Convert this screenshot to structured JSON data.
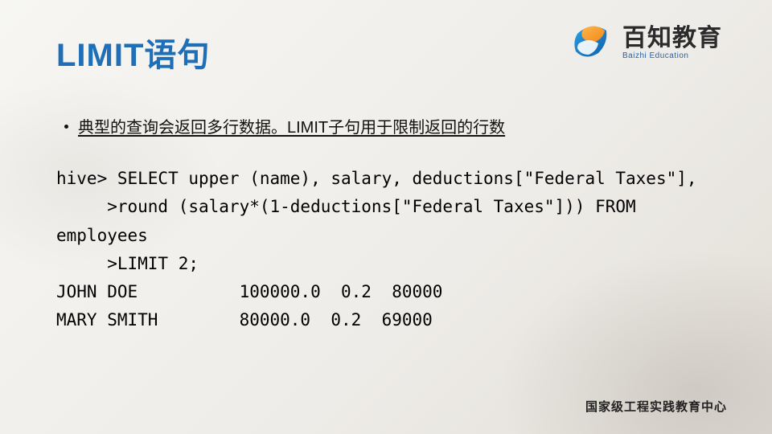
{
  "title": "LIMIT语句",
  "logo": {
    "main": "百知教育",
    "sub": "Baizhi Education"
  },
  "bullet": "典型的查询会返回多行数据。LIMIT子句用于限制返回的行数",
  "code": {
    "l1": "hive> SELECT upper (name), salary, deductions[\"Federal Taxes\"],",
    "l2": "     >round (salary*(1-deductions[\"Federal Taxes\"])) FROM",
    "l3": "employees",
    "l4": "     >LIMIT 2;",
    "l5": "JOHN DOE          100000.0  0.2  80000",
    "l6": "MARY SMITH        80000.0  0.2  69000"
  },
  "footer": "国家级工程实践教育中心",
  "chart_data": {
    "type": "table",
    "columns": [
      "name",
      "salary",
      "deductions[Federal Taxes]",
      "round(salary*(1-deductions[Federal Taxes]))"
    ],
    "rows": [
      [
        "JOHN DOE",
        100000.0,
        0.2,
        80000
      ],
      [
        "MARY SMITH",
        80000.0,
        0.2,
        69000
      ]
    ]
  }
}
